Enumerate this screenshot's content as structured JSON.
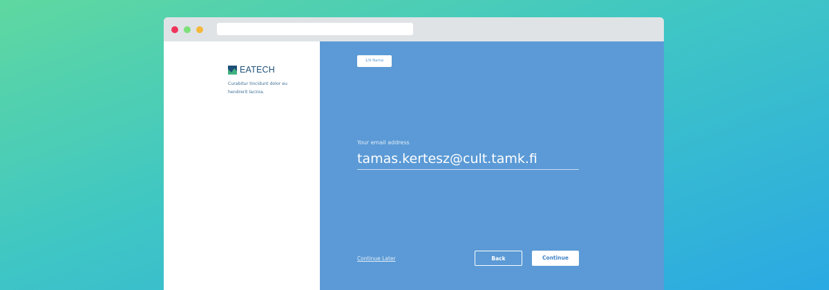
{
  "colors": {
    "accent": "#5b9ad6",
    "brand": "#1d4f78",
    "traffic_red": "#f0355c",
    "traffic_green": "#7ee07a",
    "traffic_yellow": "#f6b83c"
  },
  "window": {
    "controls": [
      "close-dot",
      "maximize-dot",
      "minimize-dot"
    ],
    "url": ""
  },
  "brand": {
    "logo_icon": "mountain-logo-icon",
    "name": "EATECH",
    "tagline": "Curabitur tincidunt dolor eu hendrerit lacinia."
  },
  "form": {
    "step_label": "1/9 Name",
    "email_label": "Your email address",
    "email_value": "tamas.kertesz@cult.tamk.fi",
    "continue_later": "Continue Later",
    "back_label": "Back",
    "continue_label": "Continue"
  }
}
